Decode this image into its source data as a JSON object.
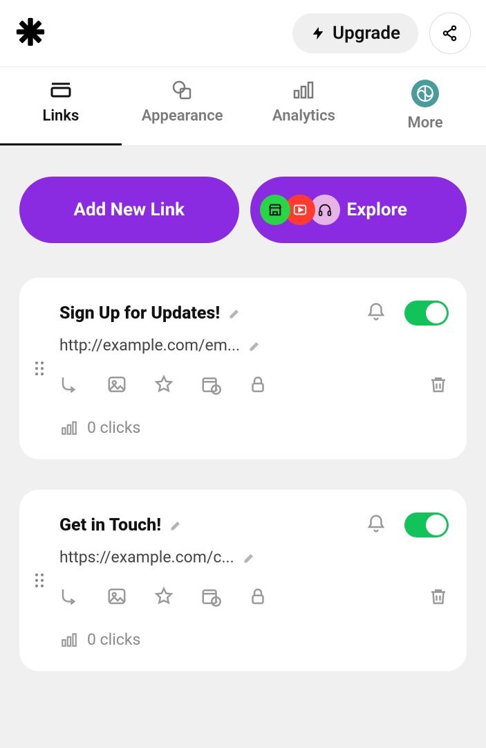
{
  "header": {
    "upgrade_label": "Upgrade"
  },
  "tabs": {
    "links": "Links",
    "appearance": "Appearance",
    "analytics": "Analytics",
    "more": "More"
  },
  "actions": {
    "add_new_link": "Add New Link",
    "explore": "Explore"
  },
  "links": [
    {
      "title": "Sign Up for Updates!",
      "url": "http://example.com/em...",
      "clicks_label": "0 clicks",
      "enabled": true
    },
    {
      "title": "Get in Touch!",
      "url": "https://example.com/c...",
      "clicks_label": "0 clicks",
      "enabled": true
    }
  ]
}
